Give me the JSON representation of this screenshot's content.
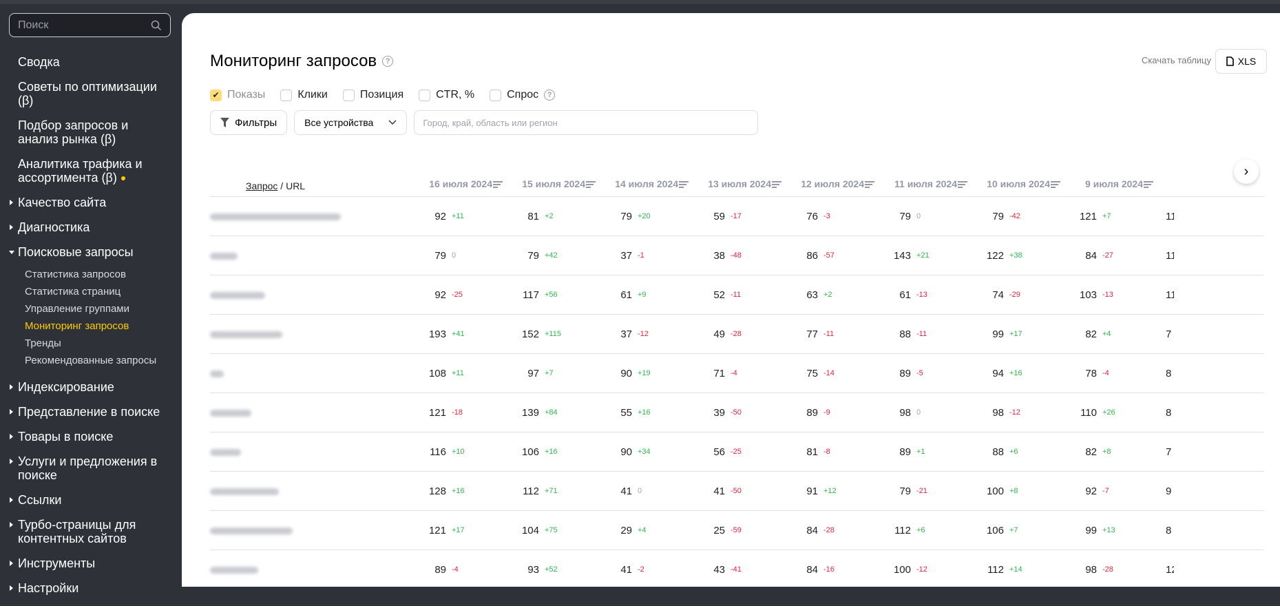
{
  "sidebar": {
    "search_placeholder": "Поиск",
    "items": [
      {
        "label": "Сводка"
      },
      {
        "label": "Советы по оптимизации (β)"
      },
      {
        "label": "Подбор запросов и анализ рынка (β)"
      },
      {
        "label": "Аналитика трафика и ассортимента (β)"
      },
      {
        "label": "Качество сайта"
      },
      {
        "label": "Диагностика"
      },
      {
        "label": "Поисковые запросы"
      },
      {
        "label": "Индексирование"
      },
      {
        "label": "Представление в поиске"
      },
      {
        "label": "Товары в поиске"
      },
      {
        "label": "Услуги и предложения в поиске"
      },
      {
        "label": "Ссылки"
      },
      {
        "label": "Турбо-страницы для контентных сайтов"
      },
      {
        "label": "Инструменты"
      },
      {
        "label": "Настройки"
      }
    ],
    "subitems": [
      "Статистика запросов",
      "Статистика страниц",
      "Управление группами",
      "Мониторинг запросов",
      "Тренды",
      "Рекомендованные запросы"
    ],
    "active_subitem": "Мониторинг запросов"
  },
  "header": {
    "title": "Мониторинг запросов",
    "download_label": "Скачать таблицу",
    "xls_label": "XLS"
  },
  "metrics": [
    {
      "label": "Показы",
      "checked": true
    },
    {
      "label": "Клики",
      "checked": false
    },
    {
      "label": "Позиция",
      "checked": false
    },
    {
      "label": "CTR, %",
      "checked": false
    },
    {
      "label": "Спрос",
      "checked": false
    }
  ],
  "filters": {
    "filters_label": "Фильтры",
    "device": "Все устройства",
    "region_placeholder": "Город, край, область или регион"
  },
  "table": {
    "query_label": "Запрос",
    "url_label": "URL",
    "columns": [
      "16 июля 2024",
      "15 июля 2024",
      "14 июля 2024",
      "13 июля 2024",
      "12 июля 2024",
      "11 июля 2024",
      "10 июля 2024",
      "9 июля 2024"
    ],
    "rows": [
      {
        "cells": [
          [
            "92",
            "+11"
          ],
          [
            "81",
            "+2"
          ],
          [
            "79",
            "+20"
          ],
          [
            "59",
            "-17"
          ],
          [
            "76",
            "-3"
          ],
          [
            "79",
            "0"
          ],
          [
            "79",
            "-42"
          ],
          [
            "121",
            "+7"
          ]
        ],
        "cut": "11"
      },
      {
        "cells": [
          [
            "79",
            "0"
          ],
          [
            "79",
            "+42"
          ],
          [
            "37",
            "-1"
          ],
          [
            "38",
            "-48"
          ],
          [
            "86",
            "-57"
          ],
          [
            "143",
            "+21"
          ],
          [
            "122",
            "+38"
          ],
          [
            "84",
            "-27"
          ]
        ],
        "cut": "11"
      },
      {
        "cells": [
          [
            "92",
            "-25"
          ],
          [
            "117",
            "+56"
          ],
          [
            "61",
            "+9"
          ],
          [
            "52",
            "-11"
          ],
          [
            "63",
            "+2"
          ],
          [
            "61",
            "-13"
          ],
          [
            "74",
            "-29"
          ],
          [
            "103",
            "-13"
          ]
        ],
        "cut": "11"
      },
      {
        "cells": [
          [
            "193",
            "+41"
          ],
          [
            "152",
            "+115"
          ],
          [
            "37",
            "-12"
          ],
          [
            "49",
            "-28"
          ],
          [
            "77",
            "-11"
          ],
          [
            "88",
            "-11"
          ],
          [
            "99",
            "+17"
          ],
          [
            "82",
            "+4"
          ]
        ],
        "cut": "7"
      },
      {
        "cells": [
          [
            "108",
            "+11"
          ],
          [
            "97",
            "+7"
          ],
          [
            "90",
            "+19"
          ],
          [
            "71",
            "-4"
          ],
          [
            "75",
            "-14"
          ],
          [
            "89",
            "-5"
          ],
          [
            "94",
            "+16"
          ],
          [
            "78",
            "-4"
          ]
        ],
        "cut": "8"
      },
      {
        "cells": [
          [
            "121",
            "-18"
          ],
          [
            "139",
            "+84"
          ],
          [
            "55",
            "+16"
          ],
          [
            "39",
            "-50"
          ],
          [
            "89",
            "-9"
          ],
          [
            "98",
            "0"
          ],
          [
            "98",
            "-12"
          ],
          [
            "110",
            "+26"
          ]
        ],
        "cut": "8"
      },
      {
        "cells": [
          [
            "116",
            "+10"
          ],
          [
            "106",
            "+16"
          ],
          [
            "90",
            "+34"
          ],
          [
            "56",
            "-25"
          ],
          [
            "81",
            "-8"
          ],
          [
            "89",
            "+1"
          ],
          [
            "88",
            "+6"
          ],
          [
            "82",
            "+8"
          ]
        ],
        "cut": "7"
      },
      {
        "cells": [
          [
            "128",
            "+16"
          ],
          [
            "112",
            "+71"
          ],
          [
            "41",
            "0"
          ],
          [
            "41",
            "-50"
          ],
          [
            "91",
            "+12"
          ],
          [
            "79",
            "-21"
          ],
          [
            "100",
            "+8"
          ],
          [
            "92",
            "-7"
          ]
        ],
        "cut": "9"
      },
      {
        "cells": [
          [
            "121",
            "+17"
          ],
          [
            "104",
            "+75"
          ],
          [
            "29",
            "+4"
          ],
          [
            "25",
            "-59"
          ],
          [
            "84",
            "-28"
          ],
          [
            "112",
            "+6"
          ],
          [
            "106",
            "+7"
          ],
          [
            "99",
            "+13"
          ]
        ],
        "cut": "8"
      },
      {
        "cells": [
          [
            "89",
            "-4"
          ],
          [
            "93",
            "+52"
          ],
          [
            "41",
            "-2"
          ],
          [
            "43",
            "-41"
          ],
          [
            "84",
            "-16"
          ],
          [
            "100",
            "-12"
          ],
          [
            "112",
            "+14"
          ],
          [
            "98",
            "-28"
          ]
        ],
        "cut": "12"
      }
    ]
  },
  "colors": {
    "accent": "#ffcc00",
    "positive": "#2db84d",
    "negative": "#e8203b",
    "sidebar_bg": "#2e3138"
  }
}
